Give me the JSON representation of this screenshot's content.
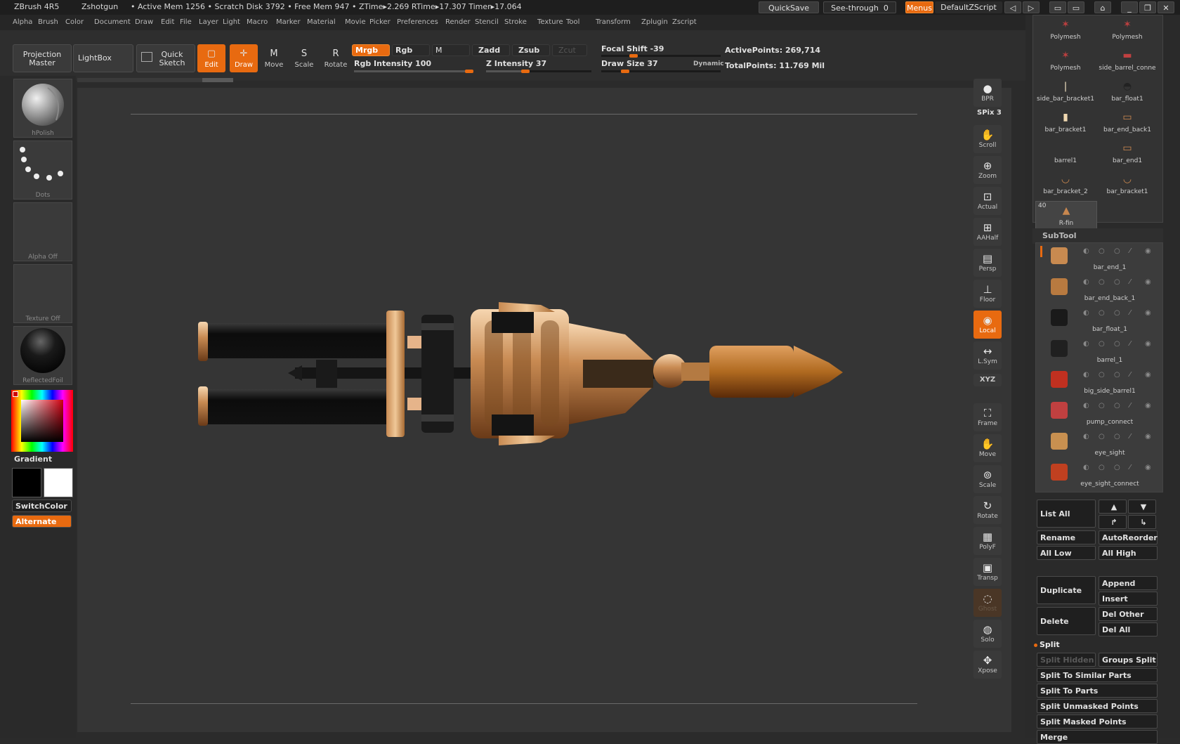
{
  "titlebar": {
    "app": "ZBrush 4R5",
    "doc": "Zshotgun",
    "stats": "• Active Mem 1256 • Scratch Disk 3792 • Free Mem 947 • ZTime▸2.269 RTime▸17.307 Timer▸17.064",
    "quicksave": "QuickSave",
    "seethrough": "See-through",
    "seethrough_val": "0",
    "menus": "Menus",
    "script": "DefaultZScript"
  },
  "menubar": [
    "Alpha",
    "Brush",
    "Color",
    "Document",
    "Draw",
    "Edit",
    "File",
    "Layer",
    "Light",
    "Macro",
    "Marker",
    "Material",
    "Movie",
    "Picker",
    "Preferences",
    "Render",
    "Stencil",
    "Stroke",
    "Texture",
    "Tool",
    "Transform",
    "Zplugin",
    "Zscript"
  ],
  "shelf": {
    "projection_master": [
      "Projection",
      "Master"
    ],
    "lightbox": "LightBox",
    "quick_sketch": [
      "Quick",
      "Sketch"
    ],
    "tools": [
      {
        "label": "Edit",
        "icon": "edit-icon",
        "on": true
      },
      {
        "label": "Draw",
        "icon": "draw-icon",
        "on": true
      },
      {
        "label": "Move",
        "icon": "move-icon",
        "on": false
      },
      {
        "label": "Scale",
        "icon": "scale-icon",
        "on": false
      },
      {
        "label": "Rotate",
        "icon": "rotate-icon",
        "on": false
      }
    ],
    "mrgb": "Mrgb",
    "rgb": "Rgb",
    "m": "M",
    "zadd": "Zadd",
    "zsub": "Zsub",
    "zcut": "Zcut",
    "rgb_intensity": "Rgb Intensity 100",
    "rgb_intensity_value": 100,
    "z_intensity": "Z Intensity 37",
    "z_intensity_value": 37,
    "focal_shift": "Focal Shift -39",
    "draw_size": "Draw Size 37",
    "dynamic": "Dynamic",
    "active_points": "ActivePoints: 269,714",
    "total_points": "TotalPoints: 11.769 Mil"
  },
  "lefttray": {
    "brush": "hPolish",
    "stroke": "Dots",
    "alpha": "Alpha Off",
    "texture": "Texture Off",
    "material": "ReflectedFoil",
    "gradient": "Gradient",
    "switchcolor": "SwitchColor",
    "alternate": "Alternate"
  },
  "rightshelf": [
    {
      "label": "BPR",
      "icon": "bpr-sphere-icon"
    },
    {
      "label": "SPix 3",
      "icon": ""
    },
    {
      "label": "Scroll",
      "icon": "scroll-hand-icon"
    },
    {
      "label": "Zoom",
      "icon": "zoom-icon"
    },
    {
      "label": "Actual",
      "icon": "actual-icon"
    },
    {
      "label": "AAHalf",
      "icon": "aahalf-icon"
    },
    {
      "label": "Persp",
      "icon": "persp-icon"
    },
    {
      "label": "Floor",
      "icon": "floor-icon"
    },
    {
      "label": "Local",
      "icon": "local-icon"
    },
    {
      "label": "L.Sym",
      "icon": "lsym-icon"
    },
    {
      "label": "XYZ",
      "icon": "xyz-icon"
    },
    {
      "label": "Frame",
      "icon": "frame-icon"
    },
    {
      "label": "Move",
      "icon": "move-hand-icon"
    },
    {
      "label": "Scale",
      "icon": "scale-icon"
    },
    {
      "label": "Rotate",
      "icon": "rotate-icon"
    },
    {
      "label": "PolyF",
      "icon": "polyf-icon"
    },
    {
      "label": "Transp",
      "icon": "transp-icon"
    },
    {
      "label": "Ghost",
      "icon": "ghost-icon"
    },
    {
      "label": "Solo",
      "icon": "solo-icon"
    },
    {
      "label": "Xpose",
      "icon": "xpose-icon"
    }
  ],
  "toolpalette": [
    {
      "name": "Polymesh"
    },
    {
      "name": "Polymesh"
    },
    {
      "name": "Polymesh"
    },
    {
      "name": "side_barrel_conne"
    },
    {
      "name": "side_bar_bracket1"
    },
    {
      "name": "bar_float1"
    },
    {
      "name": "bar_bracket1"
    },
    {
      "name": "bar_end_back1"
    },
    {
      "name": "barrel1"
    },
    {
      "name": "bar_end1"
    },
    {
      "name": "bar_bracket_2"
    },
    {
      "name": "bar_bracket1"
    },
    {
      "name": "R-fin",
      "count": "40"
    }
  ],
  "subtool": {
    "title": "SubTool",
    "items": [
      {
        "name": "bar_end_1",
        "color": "#c88a50"
      },
      {
        "name": "bar_end_back_1",
        "color": "#b87a40"
      },
      {
        "name": "bar_float_1",
        "color": "#1a1a1a"
      },
      {
        "name": "barrel_1",
        "color": "#202020"
      },
      {
        "name": "big_side_barrel1",
        "color": "#c03020"
      },
      {
        "name": "pump_connect",
        "color": "#c04040"
      },
      {
        "name": "eye_sight",
        "color": "#c89050"
      },
      {
        "name": "eye_sight_connect",
        "color": "#c04020"
      }
    ],
    "list_all": "List All",
    "rename": "Rename",
    "autoreorder": "AutoReorder",
    "all_low": "All Low",
    "all_high": "All High",
    "duplicate": "Duplicate",
    "append": "Append",
    "insert": "Insert",
    "delete": "Delete",
    "del_other": "Del Other",
    "del_all": "Del All",
    "split": "Split",
    "split_hidden": "Split Hidden",
    "groups_split": "Groups Split",
    "split_similar": "Split To Similar Parts",
    "split_parts": "Split To Parts",
    "split_unmasked": "Split Unmasked Points",
    "split_masked": "Split Masked Points",
    "merge": "Merge"
  },
  "colors": {
    "accent": "#e86a10",
    "copper": "#c8874f",
    "gunmetal": "#1c1c1c"
  }
}
